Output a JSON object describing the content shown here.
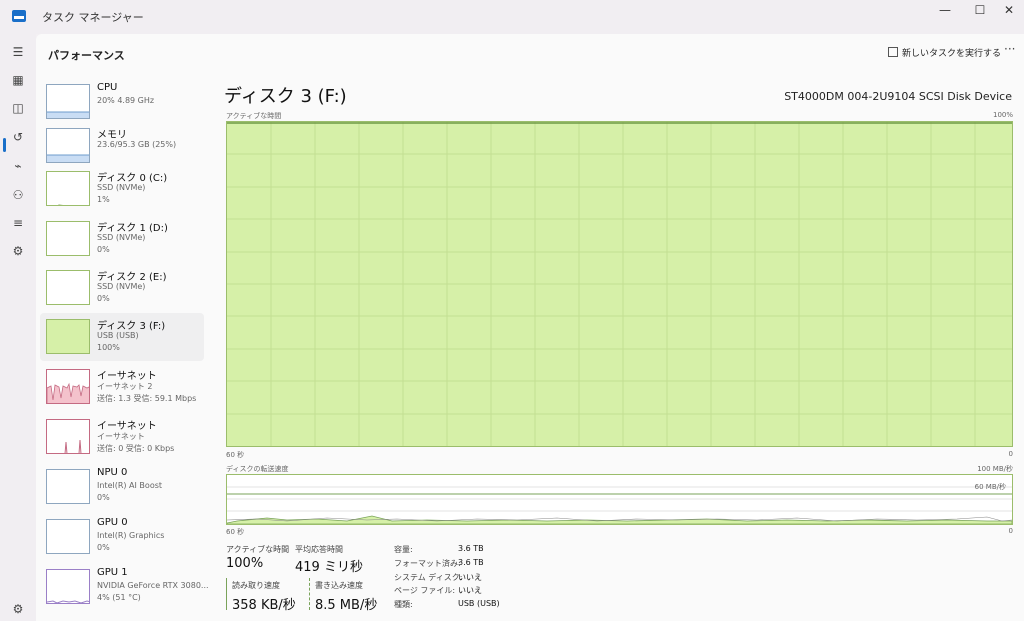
{
  "window": {
    "title": "タスク マネージャー"
  },
  "header": {
    "title": "パフォーマンス",
    "run_task": "新しいタスクを実行する",
    "more": "···"
  },
  "sidebar": [
    {
      "name": "CPU",
      "sub1": "20% 4.89 GHz",
      "sub2": ""
    },
    {
      "name": "メモリ",
      "sub1": "23.6/95.3 GB (25%)",
      "sub2": ""
    },
    {
      "name": "ディスク 0 (C:)",
      "sub1": "SSD (NVMe)",
      "sub2": "1%"
    },
    {
      "name": "ディスク 1 (D:)",
      "sub1": "SSD (NVMe)",
      "sub2": "0%"
    },
    {
      "name": "ディスク 2 (E:)",
      "sub1": "SSD (NVMe)",
      "sub2": "0%"
    },
    {
      "name": "ディスク 3 (F:)",
      "sub1": "USB (USB)",
      "sub2": "100%"
    },
    {
      "name": "イーサネット",
      "sub1": "イーサネット 2",
      "sub2": "送信: 1.3 受信: 59.1 Mbps"
    },
    {
      "name": "イーサネット",
      "sub1": "イーサネット",
      "sub2": "送信: 0 受信: 0 Kbps"
    },
    {
      "name": "NPU 0",
      "sub1": "Intel(R) AI Boost",
      "sub2": "0%"
    },
    {
      "name": "GPU 0",
      "sub1": "Intel(R) Graphics",
      "sub2": "0%"
    },
    {
      "name": "GPU 1",
      "sub1": "NVIDIA GeForce RTX 3080...",
      "sub2": "4% (51 °C)"
    }
  ],
  "detail": {
    "title": "ディスク 3 (F:)",
    "model": "ST4000DM 004-2U9104 SCSI Disk Device",
    "active_label": "アクティブな時間",
    "active_max": "100%",
    "axis_left": "60 秒",
    "axis_right": "0",
    "rate_label": "ディスクの転送速度",
    "rate_max": "100 MB/秒",
    "rate_ref": "60 MB/秒",
    "rate_axis_left": "60 秒",
    "rate_axis_right": "0"
  },
  "stats": {
    "active_time_label": "アクティブな時間",
    "active_time": "100%",
    "avg_response_label": "平均応答時間",
    "avg_response": "419 ミリ秒",
    "read_label": "読み取り速度",
    "read": "358 KB/秒",
    "write_label": "書き込み速度",
    "write": "8.5 MB/秒"
  },
  "properties": [
    {
      "key": "容量:",
      "value": "3.6 TB"
    },
    {
      "key": "フォーマット済み:",
      "value": "3.6 TB"
    },
    {
      "key": "システム ディスク:",
      "value": "いいえ"
    },
    {
      "key": "ページ ファイル:",
      "value": "いいえ"
    },
    {
      "key": "種類:",
      "value": "USB (USB)"
    }
  ],
  "colors": {
    "accent": "#1a6fc9",
    "disk_fill": "#d6f0a8",
    "disk_border": "#9bbd6b",
    "net_fill": "#f4c2cc",
    "memory_fill": "#c9ddf4"
  }
}
